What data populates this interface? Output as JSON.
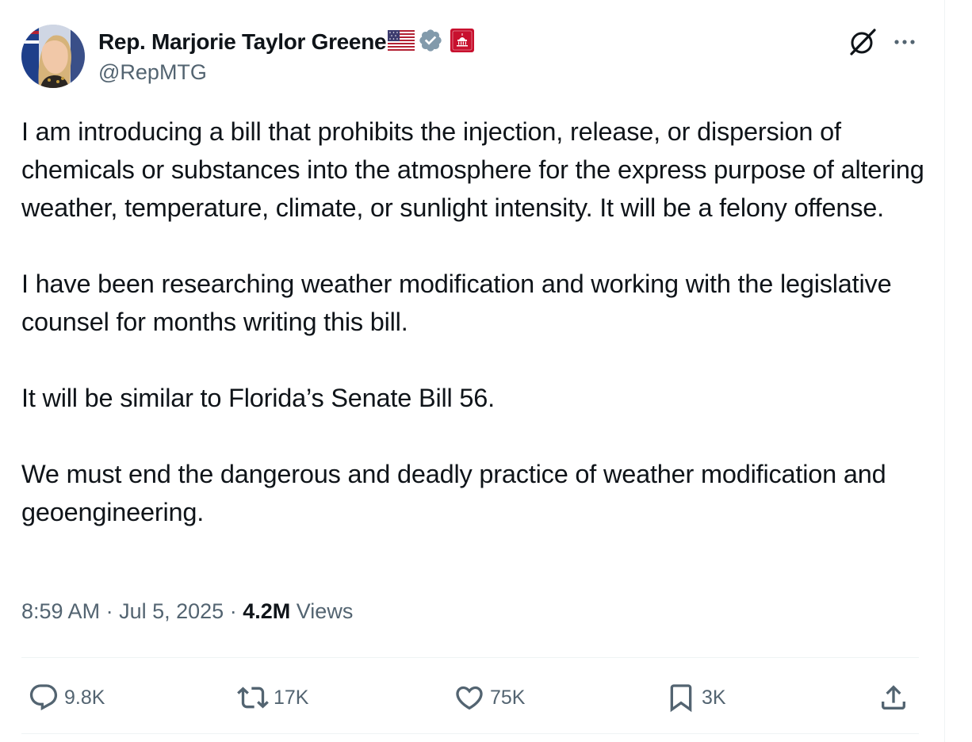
{
  "author": {
    "display_name": "Rep. Marjorie Taylor Greene",
    "handle": "@RepMTG",
    "flag_icon": "us-flag-emoji",
    "verified_icon": "verified-badge-gray",
    "affiliation_icon": "us-house-capitol-badge",
    "verified_color": "#829aab",
    "affiliation_color": "#c8102e"
  },
  "header_actions": {
    "grok_icon": "grok-icon",
    "more_icon": "more-horizontal-icon"
  },
  "tweet": {
    "paragraphs": [
      "I am introducing a bill that prohibits the injection, release, or dispersion of chemicals or substances into the atmosphere for the express purpose of altering weather, temperature, climate, or sunlight intensity. It will be a felony offense.",
      "I have been researching weather modification and working with the legislative counsel for months writing this bill.",
      "It will be similar to Florida’s Senate Bill 56.",
      "We must end the dangerous and deadly practice of weather modification and geoengineering."
    ]
  },
  "meta": {
    "time": "8:59 AM",
    "separator": "·",
    "date": "Jul 5, 2025",
    "views_count": "4.2M",
    "views_label": "Views"
  },
  "actions": {
    "replies": "9.8K",
    "reposts": "17K",
    "likes": "75K",
    "bookmarks": "3K"
  },
  "colors": {
    "text_primary": "#0f1419",
    "text_secondary": "#536471",
    "divider": "#eff3f4"
  }
}
